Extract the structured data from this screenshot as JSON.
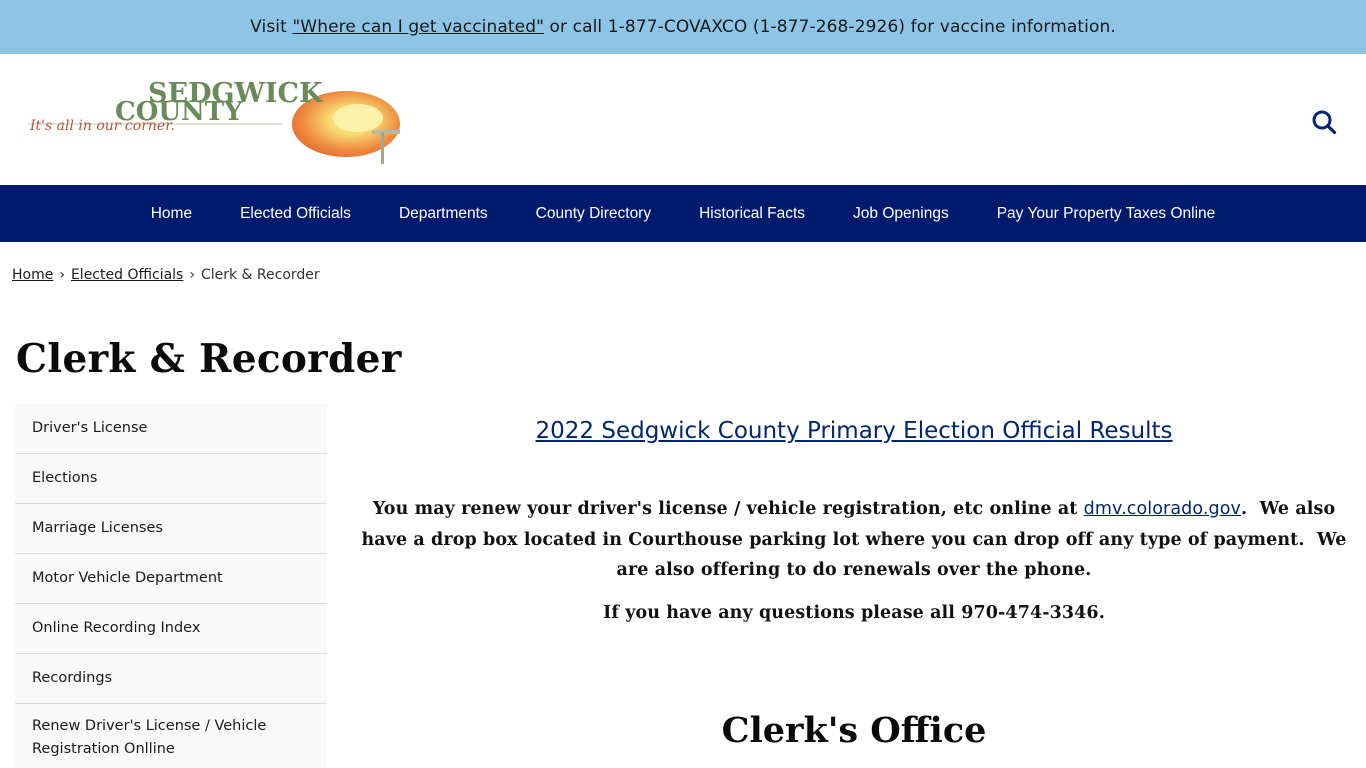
{
  "alert": {
    "prefix": "Visit ",
    "link_text": "\"Where can I get vaccinated\"",
    "suffix": " or call 1-877-COVAXCO (1-877-268-2926) for vaccine information."
  },
  "header": {
    "logo": {
      "line1": "SEDGWICK",
      "line2": "COUNTY",
      "tagline": "It's all in our corner."
    },
    "search_icon": "search-icon"
  },
  "nav": {
    "items": [
      {
        "label": "Home"
      },
      {
        "label": "Elected Officials"
      },
      {
        "label": "Departments"
      },
      {
        "label": "County Directory"
      },
      {
        "label": "Historical Facts"
      },
      {
        "label": "Job Openings"
      },
      {
        "label": "Pay Your Property Taxes Online"
      }
    ]
  },
  "breadcrumb": {
    "items": [
      "Home",
      "Elected Officials"
    ],
    "current": "Clerk & Recorder",
    "separator": "›"
  },
  "page": {
    "title": "Clerk & Recorder"
  },
  "sidebar": {
    "items": [
      {
        "label": "Driver's License"
      },
      {
        "label": "Elections"
      },
      {
        "label": "Marriage Licenses"
      },
      {
        "label": "Motor Vehicle Department"
      },
      {
        "label": "Online Recording Index"
      },
      {
        "label": "Recordings"
      },
      {
        "label": "Renew Driver's License / Vehicle Registration Onlline"
      }
    ]
  },
  "main": {
    "results_link": "2022 Sedgwick County Primary Election Official Results",
    "paragraph1_before": "You may renew your driver's license / vehicle registration, etc online at ",
    "paragraph1_link": "dmv.colorado.gov",
    "paragraph1_after": ".  We also have a drop box located in Courthouse parking lot where you can drop off any type of payment.  We are also offering to do renewals over the phone.",
    "paragraph2": "If you have any questions please all 970-474-3346.",
    "section_heading": "Clerk's Office"
  },
  "colors": {
    "alert_bg": "#8ec4e6",
    "nav_bg": "#001a6e",
    "link": "#00266e",
    "sidebar_bg": "#f9f9f9"
  }
}
